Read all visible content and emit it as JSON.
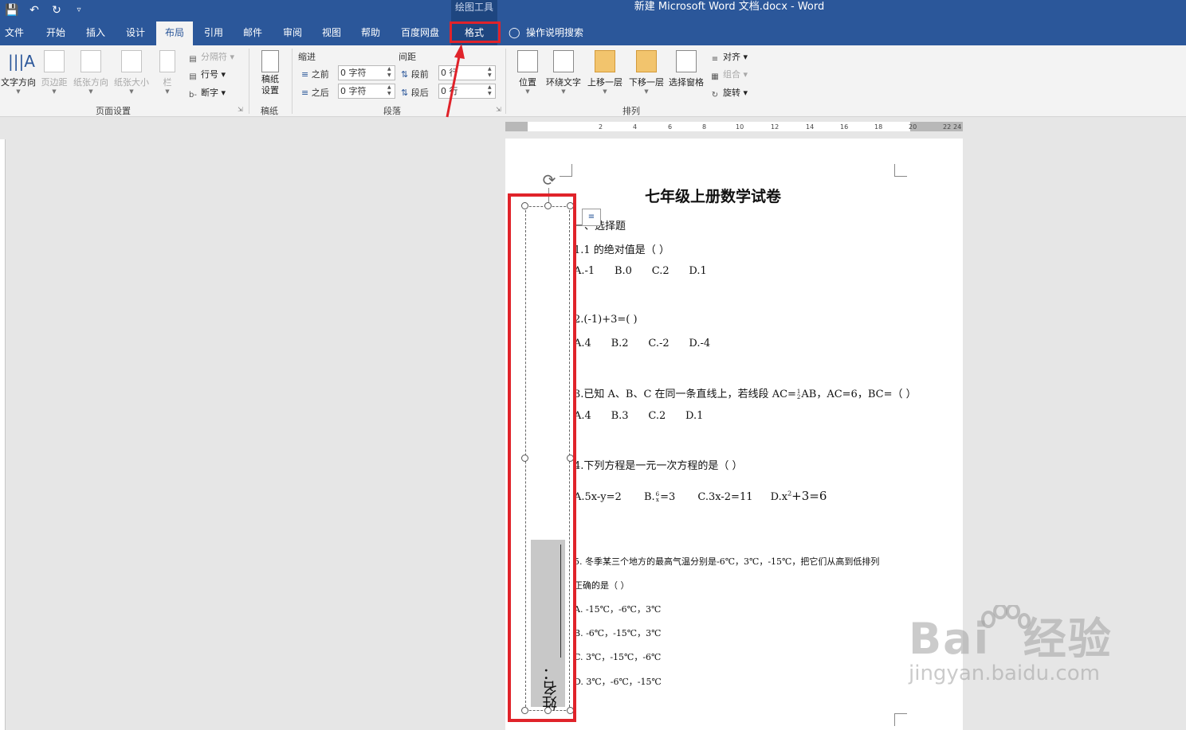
{
  "window": {
    "title": "新建 Microsoft Word 文档.docx  -  Word",
    "contextual_group": "绘图工具"
  },
  "qat": {
    "save_icon": "save-icon",
    "undo_icon": "undo-icon",
    "redo_icon": "redo-icon",
    "customize_icon": "customize-icon"
  },
  "tabs": [
    {
      "label": "文件"
    },
    {
      "label": "开始"
    },
    {
      "label": "插入"
    },
    {
      "label": "设计"
    },
    {
      "label": "布局"
    },
    {
      "label": "引用"
    },
    {
      "label": "邮件"
    },
    {
      "label": "审阅"
    },
    {
      "label": "视图"
    },
    {
      "label": "帮助"
    },
    {
      "label": "百度网盘"
    },
    {
      "label": "格式"
    }
  ],
  "tell_me": "操作说明搜索",
  "ribbon": {
    "page_setup": {
      "label": "页面设置",
      "text_direction": "文字方向",
      "margins": "页边距",
      "orientation": "纸张方向",
      "size": "纸张大小",
      "columns": "栏",
      "breaks": "分隔符",
      "line_numbers": "行号",
      "hyphenation": "断字"
    },
    "manuscript": {
      "label": "稿纸",
      "setup_line1": "稿纸",
      "setup_line2": "设置"
    },
    "paragraph": {
      "label": "段落",
      "indent_head": "缩进",
      "spacing_head": "间距",
      "indent_before_label": "之前",
      "indent_before_value": "0 字符",
      "indent_after_label": "之后",
      "indent_after_value": "0 字符",
      "spacing_before_label": "段前",
      "spacing_before_value": "0 行",
      "spacing_after_label": "段后",
      "spacing_after_value": "0 行"
    },
    "arrange": {
      "label": "排列",
      "position": "位置",
      "wrap_text": "环绕文字",
      "bring_forward": "上移一层",
      "send_backward": "下移一层",
      "selection_pane": "选择窗格",
      "align": "对齐",
      "group": "组合",
      "rotate": "旋转"
    }
  },
  "ruler": {
    "marks": [
      "2",
      "4",
      "6",
      "8",
      "10",
      "12",
      "14",
      "16",
      "18",
      "20",
      "22",
      "24"
    ]
  },
  "document": {
    "title": "七年级上册数学试卷",
    "section": "一、选择题",
    "q1": "1.1 的绝对值是（    ）",
    "q1_opts": "A.-1      B.0      C.2      D.1",
    "q2": "2.(-1)+3=(    )",
    "q2_opts": "A.4      B.2      C.-2      D.-4",
    "q3_pre": "3.已知 A、B、C 在同一条直线上，若线段 AC=",
    "q3_frac_num": "1",
    "q3_frac_den": "2",
    "q3_post": "AB，AC=6，BC=（    ）",
    "q3_opts": "A.4      B.3      C.2      D.1",
    "q4": "4.下列方程是一元一次方程的是（    ）",
    "q4_a": "A.5x-y=2",
    "q4_b_pre": "B.",
    "q4_b_num": "6",
    "q4_b_den": "x",
    "q4_b_post": "=3",
    "q4_c": "C.3x-2=11",
    "q4_d_pre": "D.x",
    "q4_d_sup": "2",
    "q4_d_post": "+3=6",
    "q5_line1": "5.  冬季某三个地方的最高气温分别是-6℃，3℃，-15℃，把它们从高到低排列",
    "q5_line2": "正确的是（    ）",
    "q5_a": "A.  -15℃，-6℃，3℃",
    "q5_b": "B.  -6℃，-15℃，3℃",
    "q5_c": "C.  3℃，-15℃，-6℃",
    "q5_d": "D.  3℃，-6℃，-15℃"
  },
  "textbox": {
    "text": "姓名："
  },
  "watermark": {
    "brand": "Bai  经验",
    "url": "jingyan.baidu.com"
  },
  "colors": {
    "accent": "#2b579a",
    "highlight": "#e0232a"
  }
}
